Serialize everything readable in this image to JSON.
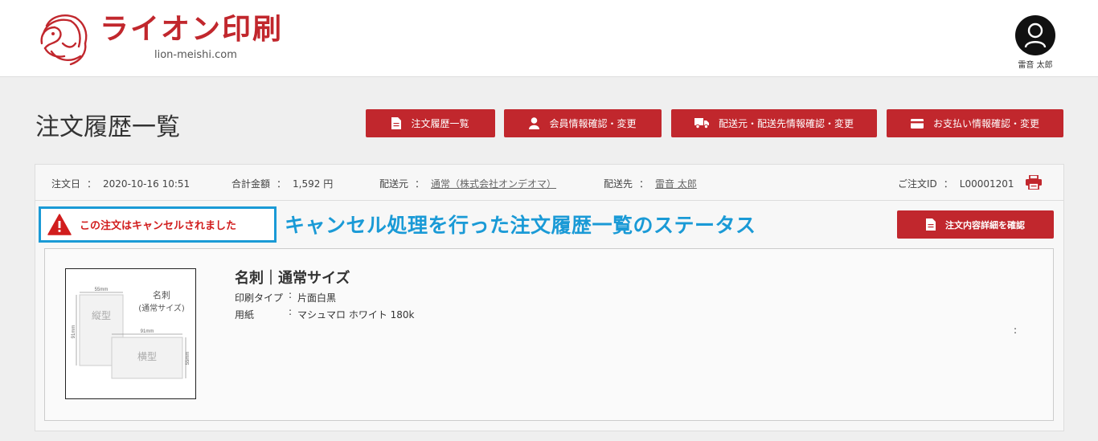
{
  "header": {
    "logo_text": "ライオン印刷",
    "logo_url": "lion-meishi.com",
    "user_name": "雷音 太郎"
  },
  "page_title": "注文履歴一覧",
  "nav": [
    {
      "label": "注文履歴一覧",
      "icon": "document-icon"
    },
    {
      "label": "会員情報確認・変更",
      "icon": "user-icon"
    },
    {
      "label": "配送元・配送先情報確認・変更",
      "icon": "truck-icon"
    },
    {
      "label": "お支払い情報確認・変更",
      "icon": "credit-card-icon"
    }
  ],
  "order": {
    "date_label": "注文日",
    "date_value": "2020-10-16 10:51",
    "total_label": "合計金額",
    "total_value": "1,592 円",
    "from_label": "配送元",
    "from_value": "通常（株式会社オンデオマ）",
    "to_label": "配送先",
    "to_value": "雷音 太郎",
    "id_label": "ご注文ID",
    "id_value": "L00001201",
    "colon": "："
  },
  "status": {
    "text": "この注文はキャンセルされました",
    "annotation": "キャンセル処理を行った注文履歴一覧のステータス",
    "detail_button": "注文内容詳細を確認"
  },
  "product": {
    "name": "名刺｜通常サイズ",
    "specs": [
      {
        "label": "印刷タイプ",
        "value": "片面白黒"
      },
      {
        "label": "用紙",
        "value": "マシュマロ ホワイト 180k"
      }
    ],
    "spec_colon": ":",
    "stray_colon": ":",
    "thumb": {
      "title_line1": "名刺",
      "title_line2": "(通常サイズ)",
      "portrait": "縦型",
      "landscape": "横型",
      "dim_55": "55mm",
      "dim_91": "91mm"
    }
  },
  "colors": {
    "brand_red": "#c1272d",
    "annotation_blue": "#1a9ad6",
    "status_red": "#d11d1d"
  }
}
